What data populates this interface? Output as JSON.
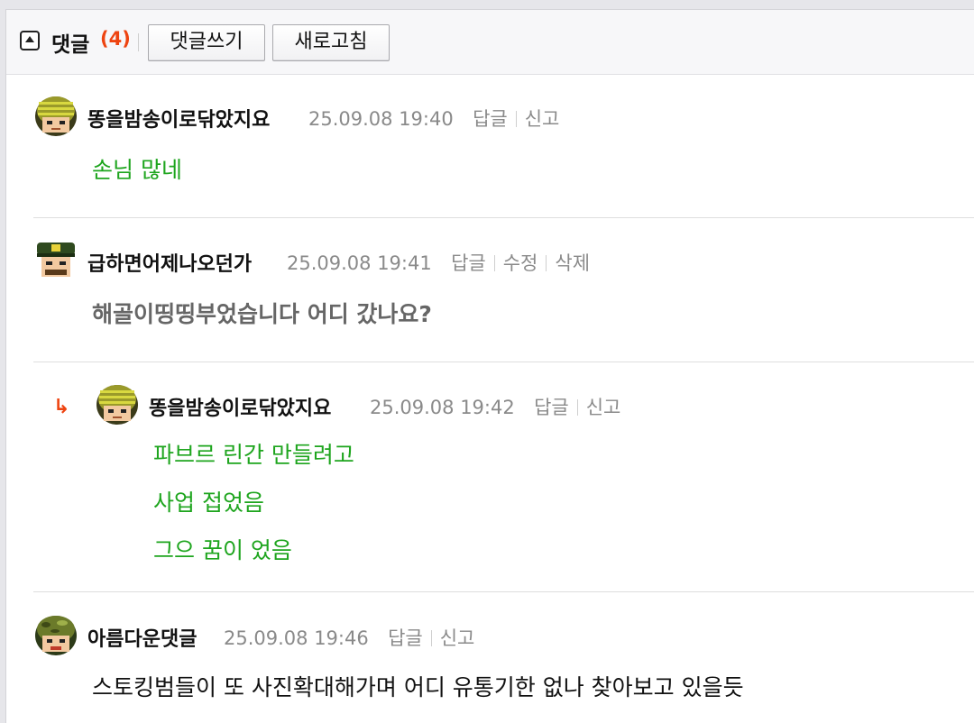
{
  "toolbar": {
    "title": "댓글",
    "count": "(4)",
    "write_label": "댓글쓰기",
    "refresh_label": "새로고침"
  },
  "comments": [
    {
      "nick": "똥을밤송이로닦았지요",
      "date": "25.09.08 19:40",
      "actions": [
        "답글",
        "신고"
      ],
      "lines": [
        "손님 많네"
      ],
      "text_color": "#1ea51e",
      "avatar_icon": "striped-helmet-avatar-icon"
    },
    {
      "nick": "급하면어제나오던가",
      "date": "25.09.08 19:41",
      "actions": [
        "답글",
        "수정",
        "삭제"
      ],
      "lines": [
        "해골이띵띵부었습니다 어디 갔나요?"
      ],
      "text_color": "#666666",
      "avatar_icon": "officer-cap-avatar-icon"
    },
    {
      "reply_marker": "↳",
      "nick": "똥을밤송이로닦았지요",
      "date": "25.09.08 19:42",
      "actions": [
        "답글",
        "신고"
      ],
      "lines": [
        "파브르 린간 만들려고",
        "사업 접었음",
        "그으 꿈이 었음"
      ],
      "text_color": "#1ea51e",
      "avatar_icon": "striped-helmet-avatar-icon"
    },
    {
      "nick": "아름다운댓글",
      "date": "25.09.08 19:46",
      "actions": [
        "답글",
        "신고"
      ],
      "lines": [
        "스토킹범들이 또 사진확대해가며 어디 유통기한 없나 찾아보고 있을듯"
      ],
      "text_color": "#111111",
      "avatar_icon": "camo-helmet-avatar-icon"
    }
  ]
}
